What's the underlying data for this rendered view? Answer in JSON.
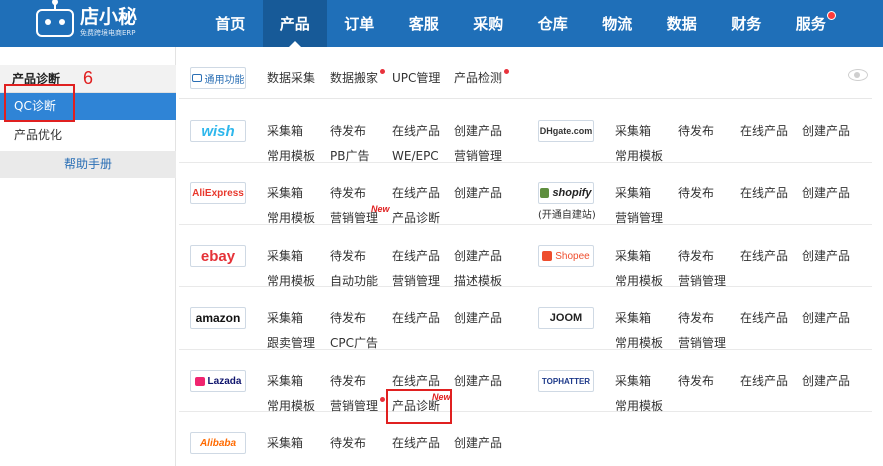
{
  "brand": {
    "name": "店小秘",
    "tagline": "免费跨境电商ERP"
  },
  "nav": [
    {
      "label": "首页",
      "active": false,
      "dot": false
    },
    {
      "label": "产品",
      "active": true,
      "dot": false
    },
    {
      "label": "订单",
      "active": false,
      "dot": false
    },
    {
      "label": "客服",
      "active": false,
      "dot": false
    },
    {
      "label": "采购",
      "active": false,
      "dot": false
    },
    {
      "label": "仓库",
      "active": false,
      "dot": false
    },
    {
      "label": "物流",
      "active": false,
      "dot": false
    },
    {
      "label": "数据",
      "active": false,
      "dot": false
    },
    {
      "label": "财务",
      "active": false,
      "dot": false
    },
    {
      "label": "服务",
      "active": false,
      "dot": true
    }
  ],
  "sidebar": {
    "header": "产品诊断",
    "annotation": "6",
    "items": [
      {
        "label": "QC诊断",
        "active": true
      },
      {
        "label": "产品优化",
        "active": false
      }
    ],
    "help": "帮助手册"
  },
  "panel": {
    "general": {
      "badge": "通用功能",
      "links": [
        "数据采集",
        "数据搬家",
        "UPC管理",
        "产品检测"
      ]
    },
    "new_tag": "New",
    "platforms": [
      {
        "name": "wish",
        "links": [
          "采集箱",
          "待发布",
          "在线产品",
          "创建产品",
          "常用模板",
          "PB广告",
          "WE/EPC",
          "营销管理"
        ]
      },
      {
        "name": "DHgate.com",
        "links": [
          "采集箱",
          "待发布",
          "在线产品",
          "创建产品",
          "常用模板"
        ]
      },
      {
        "name": "AliExpress",
        "links": [
          "采集箱",
          "待发布",
          "在线产品",
          "创建产品",
          "常用模板",
          "营销管理",
          "产品诊断"
        ]
      },
      {
        "name": "shopify",
        "sub": "(开通自建站)",
        "links": [
          "采集箱",
          "待发布",
          "在线产品",
          "创建产品",
          "营销管理"
        ]
      },
      {
        "name": "ebay",
        "links": [
          "采集箱",
          "待发布",
          "在线产品",
          "创建产品",
          "常用模板",
          "自动功能",
          "营销管理",
          "描述模板"
        ]
      },
      {
        "name": "Shopee",
        "links": [
          "采集箱",
          "待发布",
          "在线产品",
          "创建产品",
          "常用模板",
          "营销管理"
        ]
      },
      {
        "name": "amazon",
        "links": [
          "采集箱",
          "待发布",
          "在线产品",
          "创建产品",
          "跟卖管理",
          "CPC广告"
        ]
      },
      {
        "name": "JOOM",
        "links": [
          "采集箱",
          "待发布",
          "在线产品",
          "创建产品",
          "常用模板",
          "营销管理"
        ]
      },
      {
        "name": "Lazada",
        "links": [
          "采集箱",
          "待发布",
          "在线产品",
          "创建产品",
          "常用模板",
          "营销管理",
          "产品诊断"
        ]
      },
      {
        "name": "TOPHATTER",
        "links": [
          "采集箱",
          "待发布",
          "在线产品",
          "创建产品",
          "常用模板"
        ]
      },
      {
        "name": "Alibaba",
        "links": [
          "采集箱",
          "待发布",
          "在线产品",
          "创建产品"
        ]
      }
    ]
  },
  "colors": {
    "topbar": "#1f6fb8",
    "active_nav": "#175a98",
    "sidebar_active": "#2f84d6",
    "annotation": "#e02020"
  }
}
